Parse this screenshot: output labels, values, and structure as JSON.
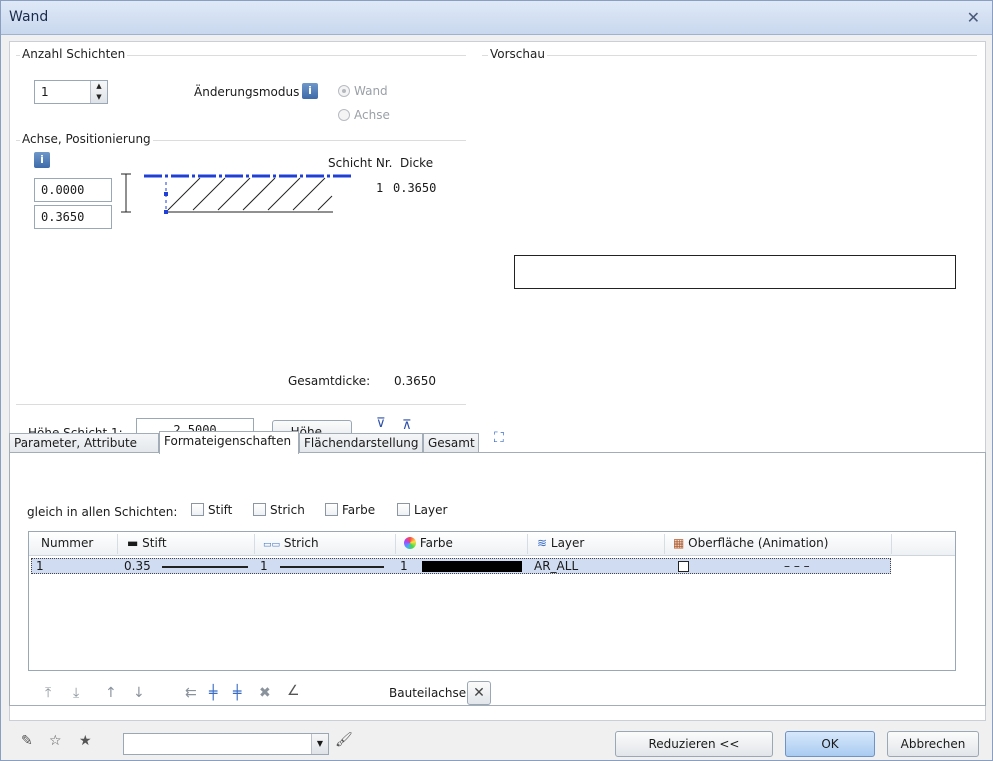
{
  "window": {
    "title": "Wand"
  },
  "layers": {
    "group_title": "Anzahl Schichten",
    "count": "1",
    "change_mode_label": "Änderungsmodus",
    "mode_wand": "Wand",
    "mode_achse": "Achse"
  },
  "axis": {
    "group_title": "Achse, Positionierung",
    "col_layer_nr": "Schicht Nr.",
    "col_thickness": "Dicke",
    "top_value": "0.0000",
    "bottom_value": "0.3650",
    "layer_row_nr": "1",
    "layer_row_thickness": "0.3650",
    "total_label": "Gesamtdicke:",
    "total_value": "0.3650"
  },
  "height": {
    "label": "Höhe Schicht 1:",
    "value": "2.5000",
    "button": "Höhe..."
  },
  "preview": {
    "group_title": "Vorschau"
  },
  "tabs": [
    {
      "label": "Parameter, Attribute"
    },
    {
      "label": "Formateigenschaften"
    },
    {
      "label": "Flächendarstellung"
    },
    {
      "label": "Gesamt"
    }
  ],
  "format": {
    "same_in_all_label": "gleich in allen Schichten:",
    "chk_stift": "Stift",
    "chk_strich": "Strich",
    "chk_farbe": "Farbe",
    "chk_layer": "Layer",
    "columns": [
      "Nummer",
      "Stift",
      "Strich",
      "Farbe",
      "Layer",
      "Oberfläche (Animation)"
    ],
    "row": {
      "nummer": "1",
      "stift": "0.35",
      "strich": "1",
      "farbe": "1",
      "layer": "AR_ALL",
      "oberflaeche": "– – –"
    },
    "bauteilachse_label": "Bauteilachse"
  },
  "footer": {
    "combo_value": "",
    "reduce_button": "Reduzieren <<",
    "ok_button": "OK",
    "cancel_button": "Abbrechen"
  },
  "colors": {
    "accent_blue": "#1f3fd6",
    "selection": "#cfdcf2"
  }
}
